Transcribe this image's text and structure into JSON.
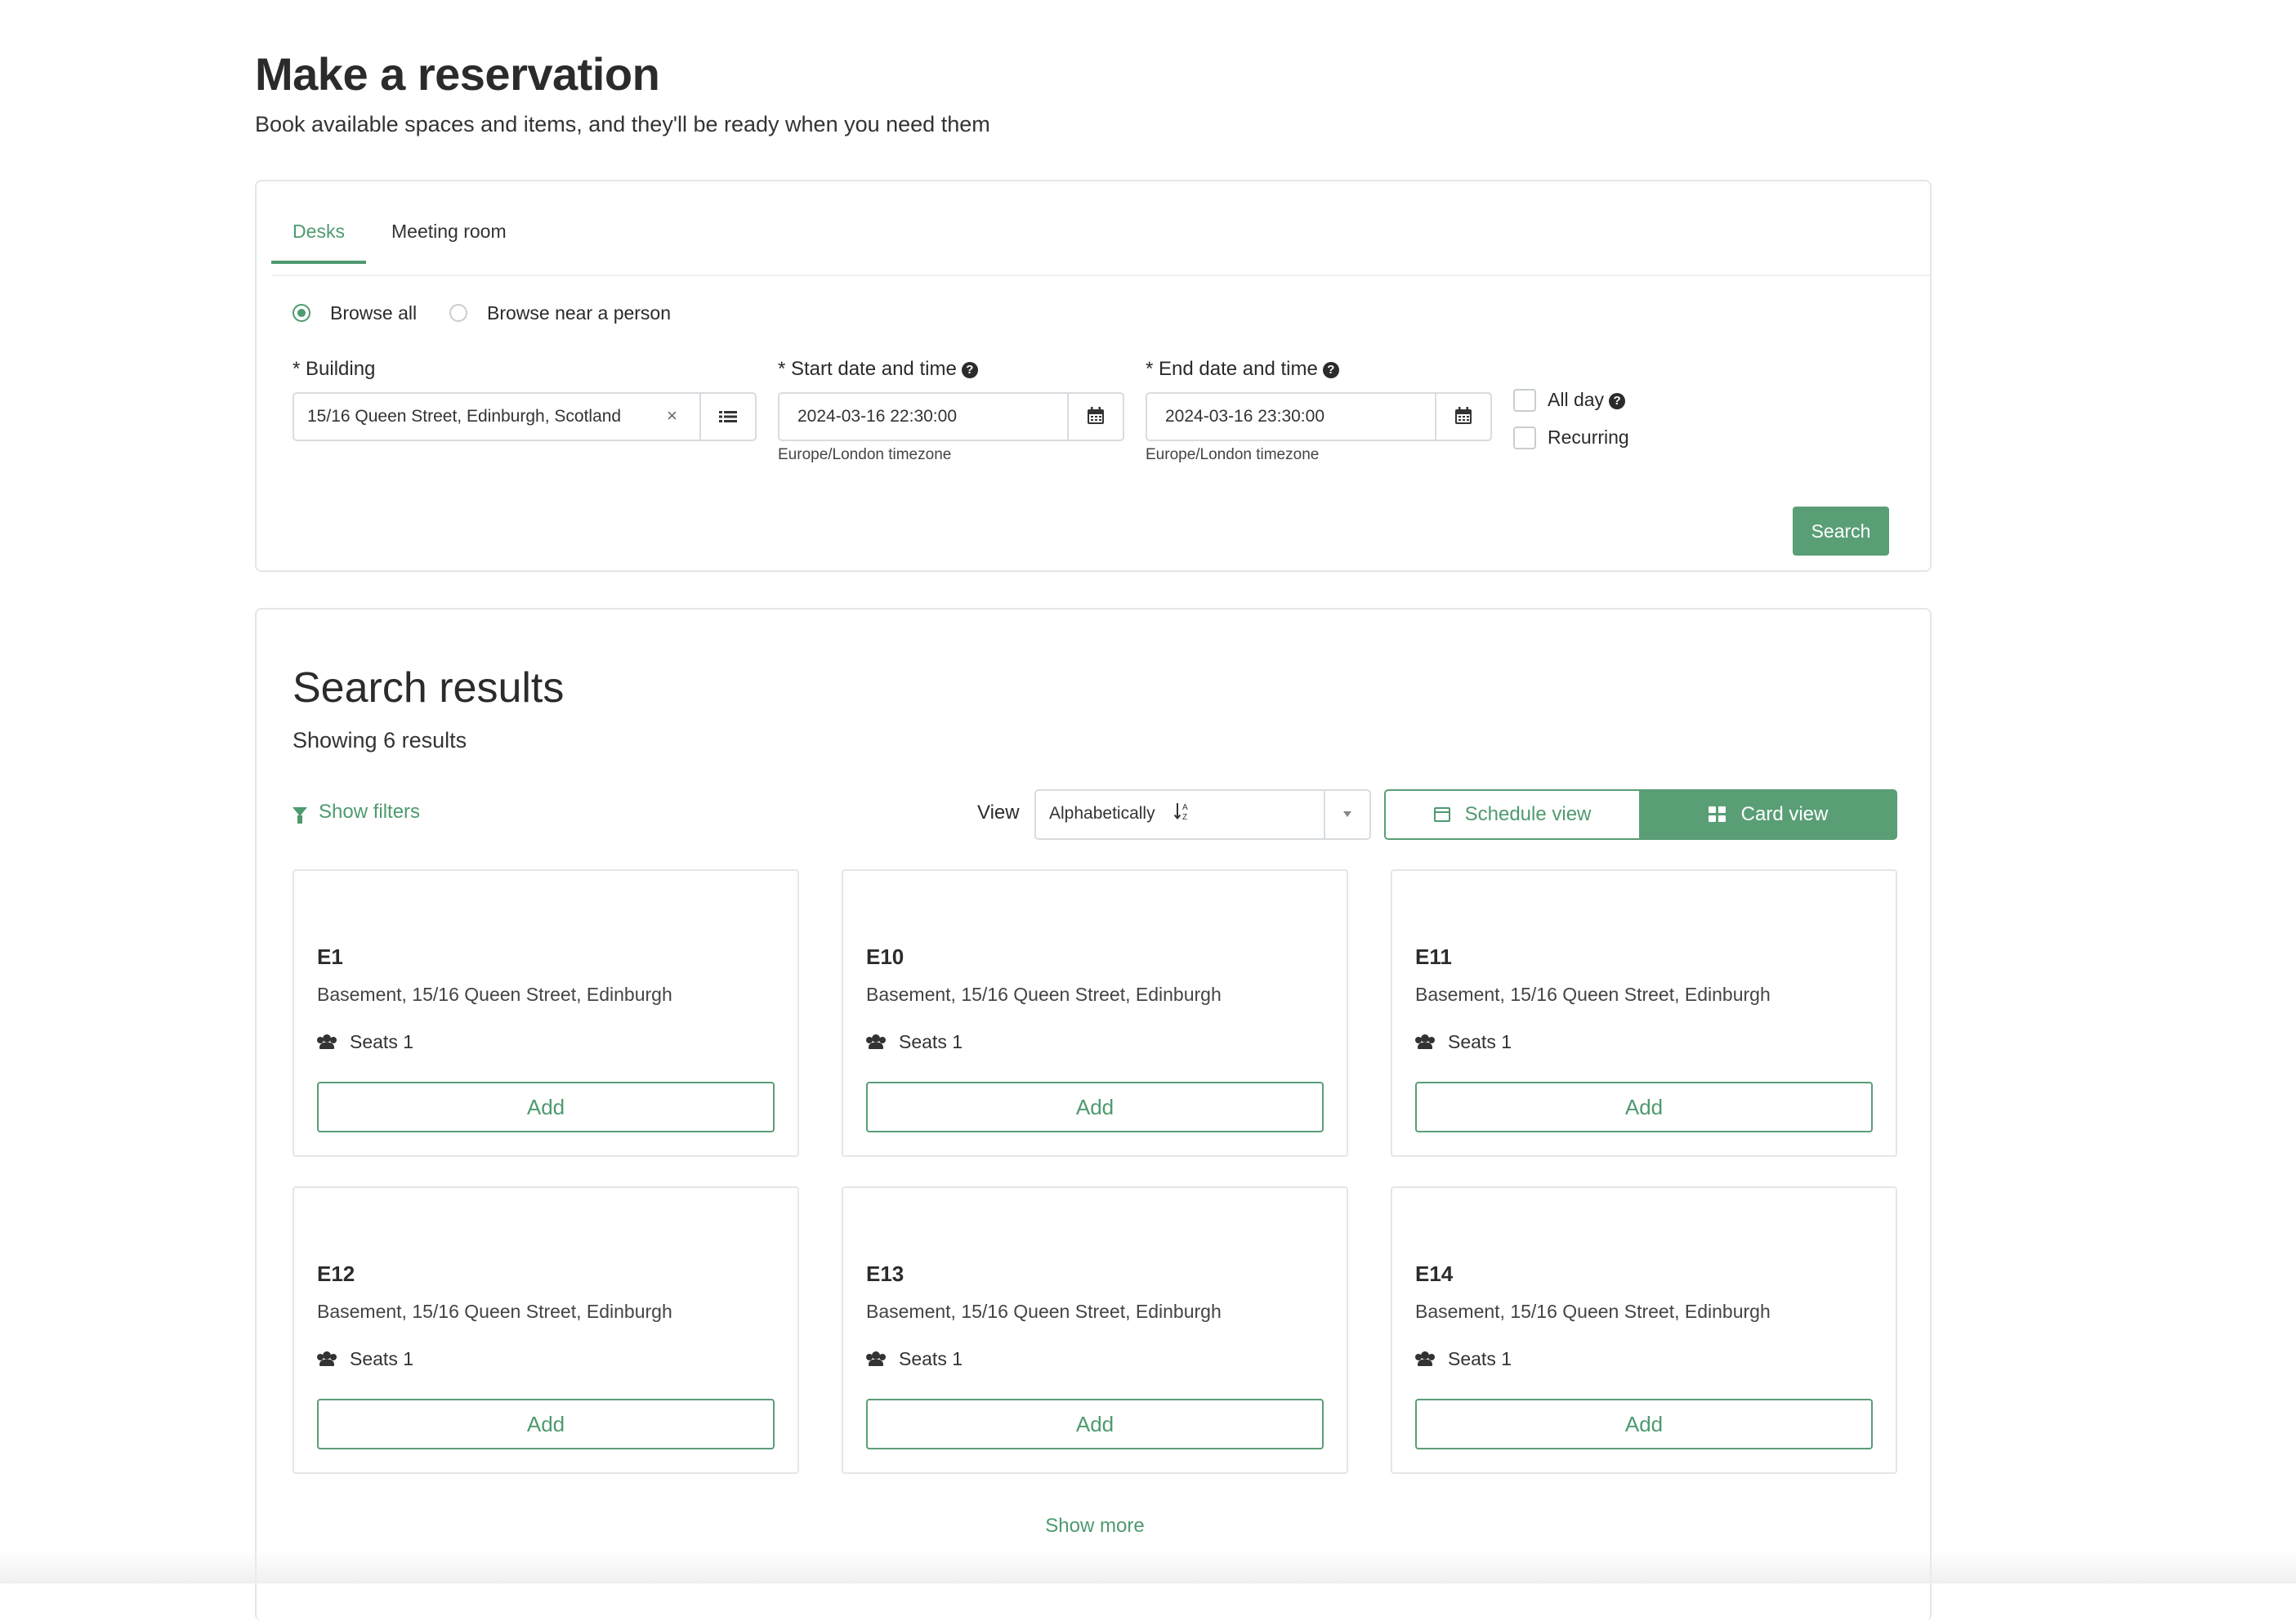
{
  "header": {
    "title": "Make a reservation",
    "subtitle": "Book available spaces and items, and they'll be ready when you need them"
  },
  "tabs": [
    {
      "label": "Desks",
      "active": true
    },
    {
      "label": "Meeting room",
      "active": false
    }
  ],
  "browse_mode": {
    "options": [
      {
        "label": "Browse all",
        "selected": true
      },
      {
        "label": "Browse near a person",
        "selected": false
      }
    ]
  },
  "form": {
    "building": {
      "label": "* Building",
      "value": "15/16 Queen Street, Edinburgh, Scotland",
      "clear_glyph": "×"
    },
    "start": {
      "label": "* Start date and time",
      "value": "2024-03-16 22:30:00",
      "timezone": "Europe/London timezone"
    },
    "end": {
      "label": "* End date and time",
      "value": "2024-03-16 23:30:00",
      "timezone": "Europe/London timezone"
    },
    "all_day": {
      "label": "All day",
      "checked": false
    },
    "recurring": {
      "label": "Recurring",
      "checked": false
    },
    "help_glyph": "?",
    "search_label": "Search"
  },
  "results": {
    "title": "Search results",
    "count_text": "Showing 6 results",
    "show_filters_label": "Show filters",
    "view_label": "View",
    "sort_value": "Alphabetically",
    "sort_glyph": "↓A Z",
    "schedule_view_label": "Schedule view",
    "card_view_label": "Card view",
    "active_view": "card",
    "show_more_label": "Show more",
    "cards": [
      {
        "name": "E1",
        "location": "Basement, 15/16 Queen Street, Edinburgh",
        "seats": "Seats 1",
        "action": "Add"
      },
      {
        "name": "E10",
        "location": "Basement, 15/16 Queen Street, Edinburgh",
        "seats": "Seats 1",
        "action": "Add"
      },
      {
        "name": "E11",
        "location": "Basement, 15/16 Queen Street, Edinburgh",
        "seats": "Seats 1",
        "action": "Add"
      },
      {
        "name": "E12",
        "location": "Basement, 15/16 Queen Street, Edinburgh",
        "seats": "Seats 1",
        "action": "Add"
      },
      {
        "name": "E13",
        "location": "Basement, 15/16 Queen Street, Edinburgh",
        "seats": "Seats 1",
        "action": "Add"
      },
      {
        "name": "E14",
        "location": "Basement, 15/16 Queen Street, Edinburgh",
        "seats": "Seats 1",
        "action": "Add"
      }
    ]
  },
  "colors": {
    "accent": "#5a9e76",
    "accent_text": "#4e9a6f",
    "border": "#e4e6e8"
  },
  "icons": {
    "building_addon": "list-icon",
    "date_addon": "calendar-icon",
    "filter": "filter-icon",
    "schedule": "calendar-icon",
    "card": "grid-icon",
    "seats": "users-icon"
  }
}
